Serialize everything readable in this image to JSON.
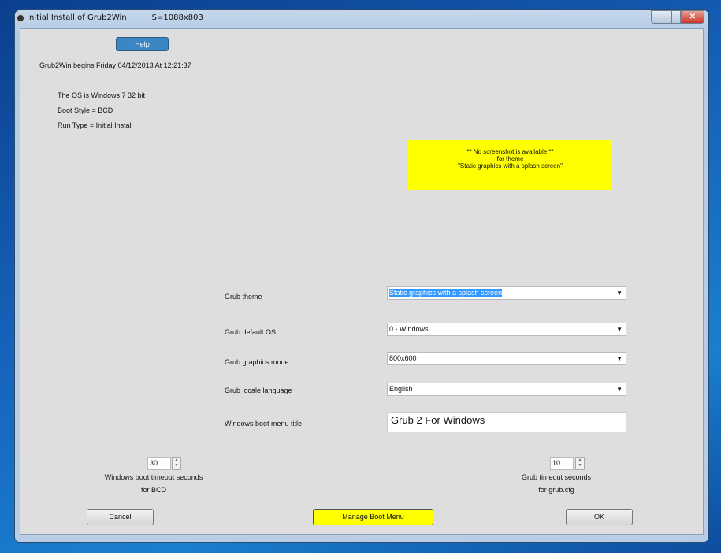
{
  "window": {
    "title": "Initial Install of Grub2Win",
    "size_info": "S=1088x803"
  },
  "header": {
    "help_label": "Help",
    "begins": "Grub2Win begins   Friday 04/12/2013 At 12:21:37"
  },
  "info": [
    "The OS is Windows 7  32 bit",
    "Boot Style = BCD",
    "Run Type = Initial Install"
  ],
  "preview": {
    "line1": "** No screenshot is available **",
    "line2": "for theme",
    "line3": "\"Static graphics with a splash screen\""
  },
  "form": {
    "theme": {
      "label": "Grub theme",
      "value": "Static graphics with a splash screen"
    },
    "default_os": {
      "label": "Grub default OS",
      "value": "0  -  Windows"
    },
    "graphics": {
      "label": "Grub graphics mode",
      "value": "800x600"
    },
    "locale": {
      "label": "Grub locale language",
      "value": "English"
    },
    "menu_title": {
      "label": "Windows boot menu title",
      "value": "Grub 2 For Windows"
    }
  },
  "timeouts": {
    "windows": {
      "value": "30",
      "label1": "Windows boot timeout seconds",
      "label2": "for BCD"
    },
    "grub": {
      "value": "10",
      "label1": "Grub timeout seconds",
      "label2": "for grub.cfg"
    }
  },
  "buttons": {
    "cancel": "Cancel",
    "manage": "Manage Boot Menu",
    "ok": "OK"
  },
  "colors": {
    "highlight": "#ffff00",
    "help": "#3c86c4"
  }
}
